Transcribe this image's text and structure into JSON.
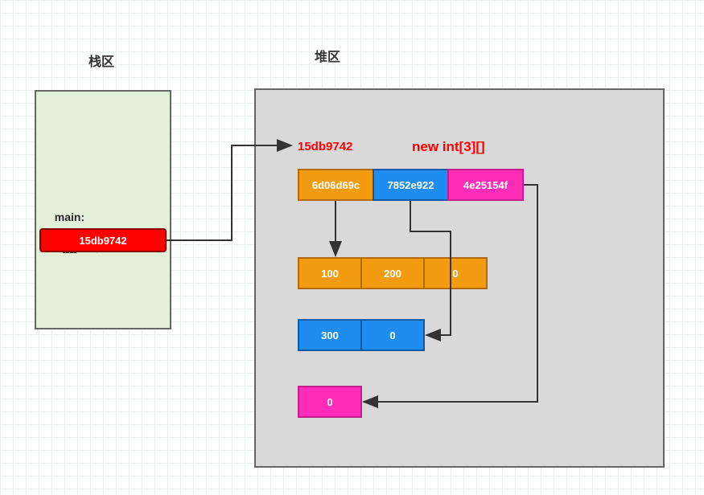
{
  "titles": {
    "stack": "栈区",
    "heap": "堆区"
  },
  "stack": {
    "code_line1": "main:",
    "code_line2": "int[][] arr;",
    "var_value": "15db9742"
  },
  "heap": {
    "address_label": "15db9742",
    "new_label": "new int[3][]",
    "outer": [
      {
        "addr": "6d06d69c",
        "color": "orange"
      },
      {
        "addr": "7852e922",
        "color": "blue"
      },
      {
        "addr": "4e25154f",
        "color": "pink"
      }
    ],
    "inner_arrays": [
      {
        "color": "orange",
        "values": [
          "100",
          "200",
          "0"
        ]
      },
      {
        "color": "blue",
        "values": [
          "300",
          "0"
        ]
      },
      {
        "color": "pink",
        "values": [
          "0"
        ]
      }
    ]
  }
}
